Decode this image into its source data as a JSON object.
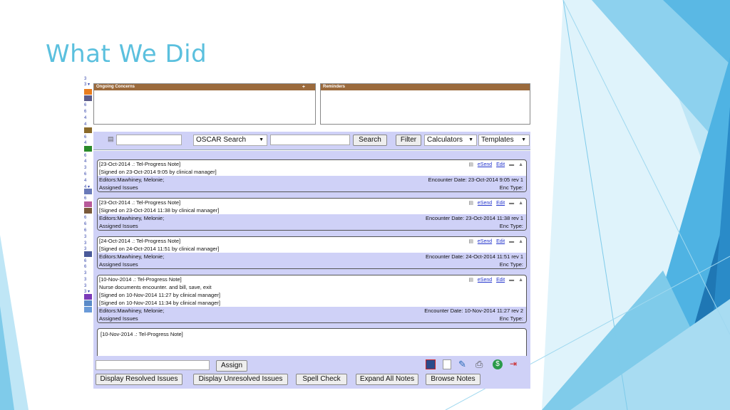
{
  "slide": {
    "title": "What We Did"
  },
  "left_strip": [
    "3",
    "3 ▾",
    "6",
    "6",
    "4",
    "4",
    "6",
    "4",
    "6",
    "4",
    "3",
    "6",
    "4",
    "4",
    "4",
    "4 ▾",
    "6",
    "6",
    "6",
    "6",
    "3",
    "3",
    "3",
    "6",
    "6",
    "3",
    "3",
    "3",
    "3 ▾"
  ],
  "panels": {
    "ongoing": {
      "title": "Ongoing Concerns",
      "plus": "+"
    },
    "reminders": {
      "title": "Reminders"
    }
  },
  "search_bar": {
    "search_select": "OSCAR Search",
    "search_button": "Search",
    "filter_button": "Filter",
    "calculators_select": "Calculators",
    "templates_select": "Templates"
  },
  "note_actions": {
    "esend": "eSend",
    "edit": "Edit"
  },
  "notes": [
    {
      "header": "[23-Oct-2014 .: Tel-Progress Note]",
      "lines": [
        "[Signed on 23-Oct-2014 9:05 by clinical manager]"
      ],
      "editors": "Editors:Mawhiney, Melonie;",
      "encounter": "Encounter Date:  23-Oct-2014 9:05  rev 1",
      "issues": "Assigned Issues",
      "enc_type": "Enc Type:"
    },
    {
      "header": "[23-Oct-2014 .: Tel-Progress Note]",
      "lines": [
        "[Signed on 23-Oct-2014 11:38 by clinical manager]"
      ],
      "editors": "Editors:Mawhiney, Melonie;",
      "encounter": "Encounter Date:  23-Oct-2014 11:38  rev 1",
      "issues": "Assigned Issues",
      "enc_type": "Enc Type:"
    },
    {
      "header": "[24-Oct-2014 .: Tel-Progress Note]",
      "lines": [
        "[Signed on 24-Oct-2014 11:51 by clinical manager]"
      ],
      "editors": "Editors:Mawhiney, Melonie;",
      "encounter": "Encounter Date:  24-Oct-2014 11:51  rev 1",
      "issues": "Assigned Issues",
      "enc_type": "Enc Type:"
    },
    {
      "header": "[10-Nov-2014 .: Tel-Progress Note]",
      "lines": [
        "Nurse documents encounter. and bill, save, exit",
        "[Signed on 10-Nov-2014 11:27 by clinical manager]",
        "[Signed on 10-Nov-2014 11:34 by clinical manager]"
      ],
      "editors": "Editors:Mawhiney, Melonie;",
      "encounter": "Encounter Date:  10-Nov-2014 11:27  rev 2",
      "issues": "Assigned Issues",
      "enc_type": "Enc Type:"
    }
  ],
  "new_note": {
    "header": "[10-Nov-2014 .: Tel-Progress Note]"
  },
  "bottom": {
    "assign_button": "Assign",
    "display_resolved": "Display Resolved Issues",
    "display_unresolved": "Display Unresolved Issues",
    "spell_check": "Spell Check",
    "expand_all": "Expand All Notes",
    "browse_notes": "Browse Notes"
  },
  "colors": {
    "title": "#5bc0de",
    "panel_header": "#9b6a3c",
    "note_band": "#cfd1f7",
    "deco_light": "#a8dcf2",
    "deco_mid": "#4fb3e3",
    "deco_dark": "#1f77b4"
  }
}
